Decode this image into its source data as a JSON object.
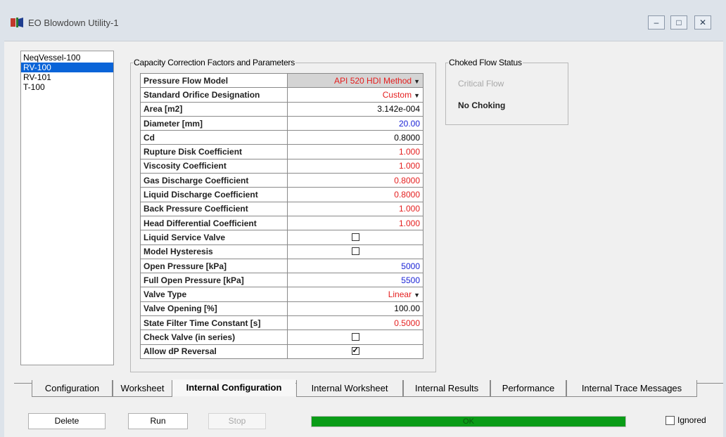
{
  "window": {
    "title": "EO Blowdown Utility-1",
    "controls": {
      "minimize": "–",
      "maximize": "□",
      "close": "✕"
    }
  },
  "units_list": {
    "items": [
      "NeqVessel-100",
      "RV-100",
      "RV-101",
      "T-100"
    ],
    "selected": "RV-100"
  },
  "capacity_group": {
    "title": "Capacity Correction Factors and Parameters",
    "rows": [
      {
        "label": "Pressure Flow Model",
        "value": "API 520 HDI Method",
        "color": "red",
        "dropdown": true
      },
      {
        "label": "Standard Orifice Designation",
        "value": "Custom",
        "color": "red",
        "dropdown": true
      },
      {
        "label": "Area [m2]",
        "value": "3.142e-004",
        "color": "black"
      },
      {
        "label": "Diameter [mm]",
        "value": "20.00",
        "color": "blue"
      },
      {
        "label": "Cd",
        "value": "0.8000",
        "color": "black"
      },
      {
        "label": "Rupture Disk Coefficient",
        "value": "1.000",
        "color": "red"
      },
      {
        "label": "Viscosity Coefficient",
        "value": "1.000",
        "color": "red"
      },
      {
        "label": "Gas Discharge Coefficient",
        "value": "0.8000",
        "color": "red"
      },
      {
        "label": "Liquid Discharge Coefficient",
        "value": "0.8000",
        "color": "red"
      },
      {
        "label": "Back Pressure Coefficient",
        "value": "1.000",
        "color": "red"
      },
      {
        "label": "Head Differential Coefficient",
        "value": "1.000",
        "color": "red"
      },
      {
        "label": "Liquid Service Valve",
        "checked": false
      },
      {
        "label": "Model Hysteresis",
        "checked": false
      },
      {
        "label": "Open Pressure [kPa]",
        "value": "5000",
        "color": "blue"
      },
      {
        "label": "Full Open Pressure [kPa]",
        "value": "5500",
        "color": "blue"
      },
      {
        "label": "Valve Type",
        "value": "Linear",
        "color": "red",
        "dropdown": true
      },
      {
        "label": "Valve Opening [%]",
        "value": "100.00",
        "color": "black"
      },
      {
        "label": "State Filter Time Constant [s]",
        "value": "0.5000",
        "color": "red"
      },
      {
        "label": "Check Valve (in series)",
        "checked": false
      },
      {
        "label": "Allow dP Reversal",
        "checked": true
      }
    ]
  },
  "choked_group": {
    "title": "Choked Flow Status",
    "critical_flow": "Critical Flow",
    "status": "No Choking"
  },
  "tabs": [
    {
      "label": "Configuration",
      "active": false
    },
    {
      "label": "Worksheet",
      "active": false
    },
    {
      "label": "Internal Configuration",
      "active": true
    },
    {
      "label": "Internal Worksheet",
      "active": false
    },
    {
      "label": "Internal Results",
      "active": false
    },
    {
      "label": "Performance",
      "active": false
    },
    {
      "label": "Internal Trace Messages",
      "active": false
    }
  ],
  "footer": {
    "delete_label": "Delete",
    "run_label": "Run",
    "stop_label": "Stop",
    "status_text": "OK",
    "status_progress": 1.0,
    "status_color": "#0a9c17",
    "ignored_label": "Ignored",
    "ignored_checked": false
  },
  "colors": {
    "red_value": "#e41e1e",
    "blue_value": "#1a23d6",
    "selection": "#0a64d8"
  }
}
